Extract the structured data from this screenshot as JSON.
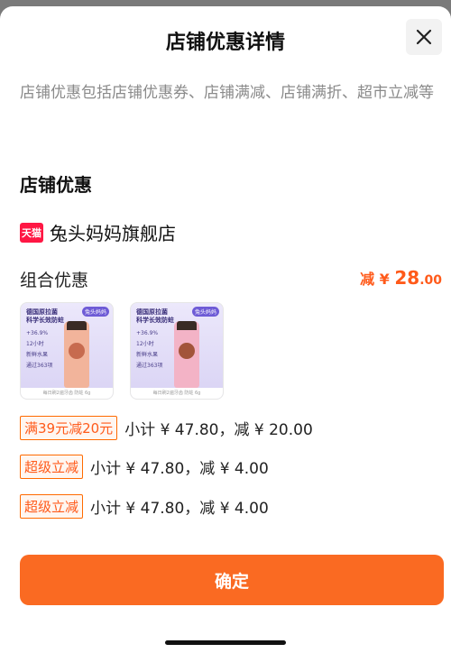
{
  "header": {
    "title": "店铺优惠详情"
  },
  "description": "店铺优惠包括店铺优惠券、店铺满减、店铺满折、超市立减等",
  "section": {
    "title": "店铺优惠"
  },
  "shop": {
    "badge": "天猫",
    "name": "兔头妈妈旗舰店"
  },
  "combo": {
    "label": "组合优惠",
    "discount_prefix": "减 ¥ ",
    "discount_int": "28",
    "discount_dec": ".00"
  },
  "products": [
    {
      "line1": "德国原拉菌",
      "line2": "科学长效防蛀",
      "badge": "兔头妈妈",
      "stats": [
        "+36.9%",
        "12小时",
        "新鲜水果",
        "通过363项"
      ],
      "strip": "每日刷2遍牙齿 防蛀 6g",
      "tube_color": "#f2b49b"
    },
    {
      "line1": "德国原拉菌",
      "line2": "科学长效防蛀",
      "badge": "兔头妈妈",
      "stats": [
        "+36.9%",
        "12小时",
        "新鲜水果",
        "通过363项"
      ],
      "strip": "每日刷2遍牙齿 防蛀 6g",
      "tube_color": "#f3b3c6"
    }
  ],
  "offers": [
    {
      "tag": "满39元减20元",
      "subtotal": "小计 ¥ 47.80，减 ¥ 20.00"
    },
    {
      "tag": "超级立减",
      "subtotal": "小计 ¥ 47.80，减 ¥ 4.00"
    },
    {
      "tag": "超级立减",
      "subtotal": "小计 ¥ 47.80，减 ¥ 4.00"
    }
  ],
  "confirm_label": "确定",
  "colors": {
    "accent": "#fa6a22",
    "discount": "#ff5a1a",
    "tmall": "#ff1744"
  },
  "icons": {
    "close": "close-icon",
    "shop": "tmall-icon"
  }
}
